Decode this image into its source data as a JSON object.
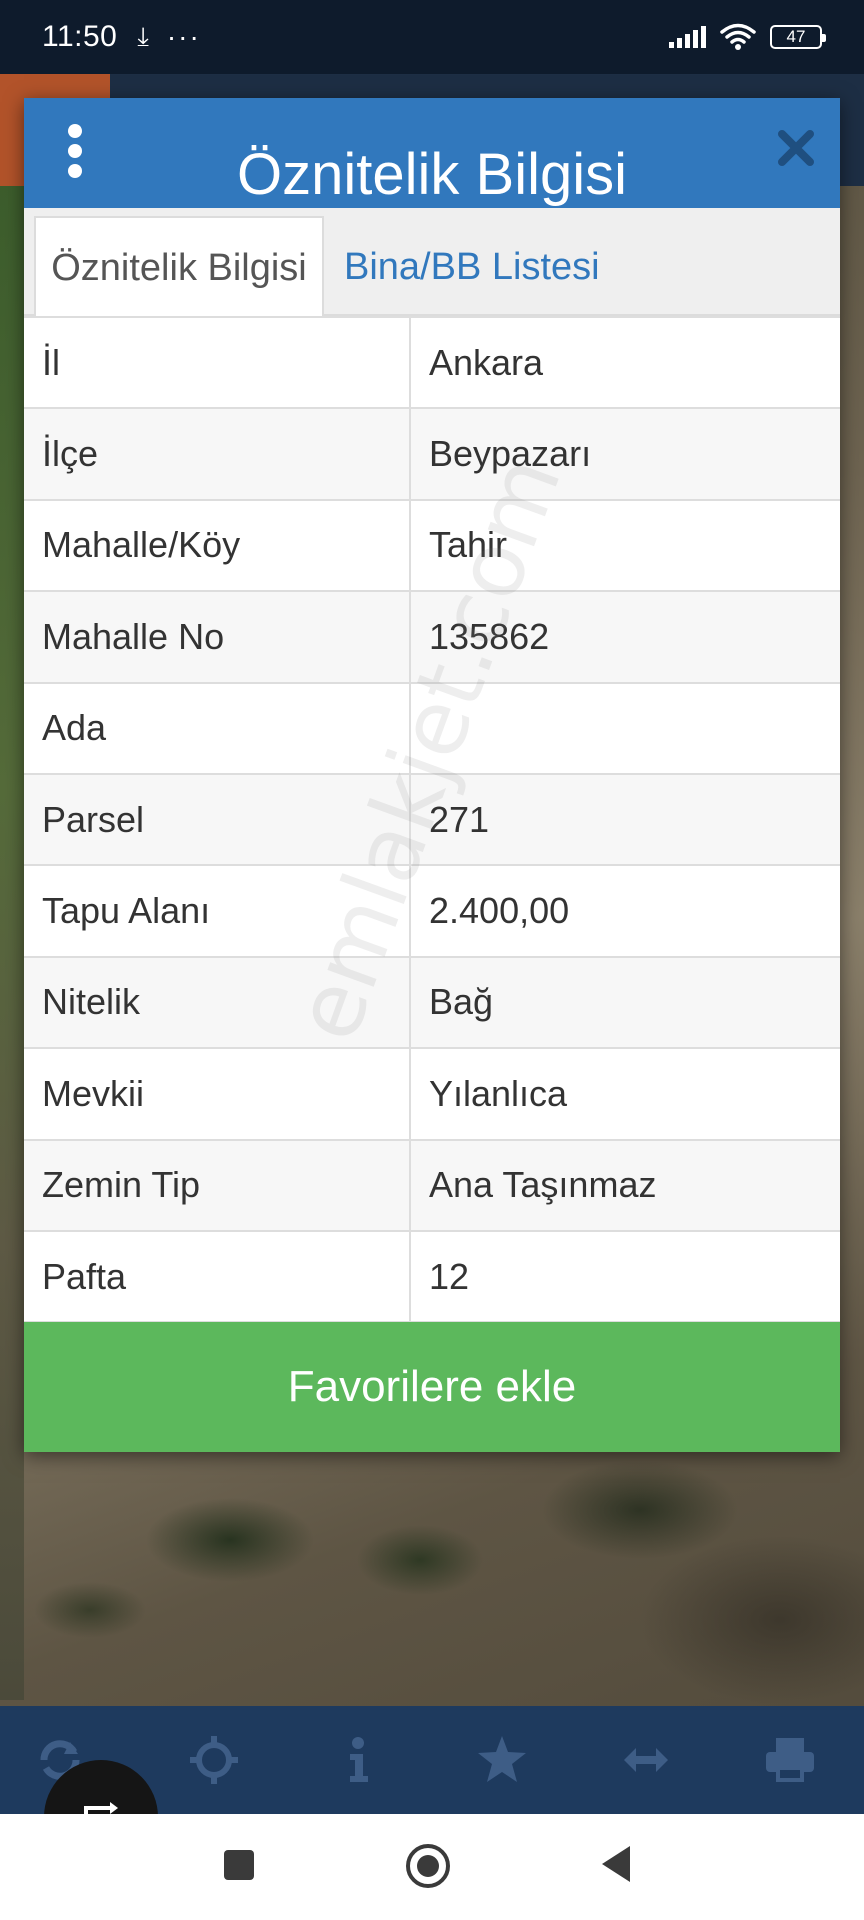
{
  "status_bar": {
    "time": "11:50",
    "download_glyph": "⤓",
    "more_glyph": "···",
    "battery": "47"
  },
  "dialog": {
    "title": "Öznitelik Bilgisi",
    "tabs": [
      {
        "label": "Öznitelik Bilgisi",
        "active": true
      },
      {
        "label": "Bina/BB Listesi",
        "active": false
      }
    ],
    "rows": [
      {
        "key": "İl",
        "value": "Ankara"
      },
      {
        "key": "İlçe",
        "value": "Beypazarı"
      },
      {
        "key": "Mahalle/Köy",
        "value": "Tahir"
      },
      {
        "key": "Mahalle No",
        "value": "135862"
      },
      {
        "key": "Ada",
        "value": ""
      },
      {
        "key": "Parsel",
        "value": "271"
      },
      {
        "key": "Tapu Alanı",
        "value": "2.400,00"
      },
      {
        "key": "Nitelik",
        "value": "Bağ"
      },
      {
        "key": "Mevkii",
        "value": "Yılanlıca"
      },
      {
        "key": "Zemin Tip",
        "value": "Ana Taşınmaz"
      },
      {
        "key": "Pafta",
        "value": "12"
      }
    ],
    "favorite_button": "Favorilere ekle"
  },
  "watermark": "emlakjet.com",
  "toolbar": {
    "icons": [
      "refresh-icon",
      "crosshair-icon",
      "info-icon",
      "star-icon",
      "measure-icon",
      "print-icon"
    ]
  },
  "colors": {
    "header_blue": "#3178bd",
    "button_green": "#5cb85c",
    "toolbar_navy": "#1e3a5e",
    "status_bar": "#0e1b2c"
  }
}
